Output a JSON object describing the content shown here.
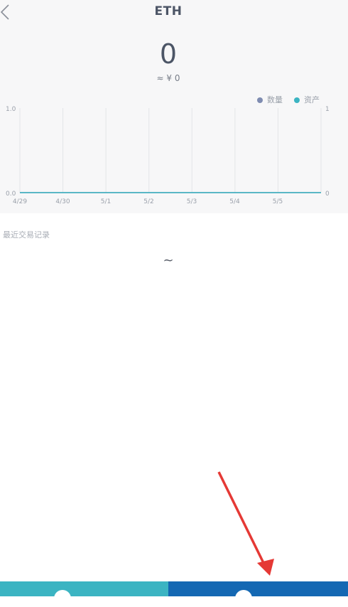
{
  "header": {
    "title": "ETH",
    "back_icon": "chevron-left-icon"
  },
  "balance": {
    "amount": "0",
    "fiat": "≈ ¥ 0"
  },
  "legend": [
    {
      "label": "数量",
      "color": "#7f8cb1"
    },
    {
      "label": "资产",
      "color": "#3bb4c2"
    }
  ],
  "chart_data": {
    "type": "line",
    "x": [
      "4/29",
      "4/30",
      "5/1",
      "5/2",
      "5/3",
      "5/4",
      "5/5"
    ],
    "series": [
      {
        "name": "数量",
        "values": [
          0,
          0,
          0,
          0,
          0,
          0,
          0,
          0
        ]
      },
      {
        "name": "资产",
        "values": [
          0,
          0,
          0,
          0,
          0,
          0,
          0,
          0
        ]
      }
    ],
    "y_left_ticks": [
      "1.0",
      "0.0"
    ],
    "y_right_ticks": [
      "1",
      "0"
    ],
    "ylim": [
      0,
      1
    ],
    "grid": true,
    "legend_position": "top-right"
  },
  "transactions": {
    "title": "最近交易记录",
    "empty": "~"
  },
  "bottom_bar": {
    "left_color": "#3bb4c2",
    "right_color": "#1468b3"
  },
  "annotation": {
    "arrow_color": "#e53935"
  }
}
